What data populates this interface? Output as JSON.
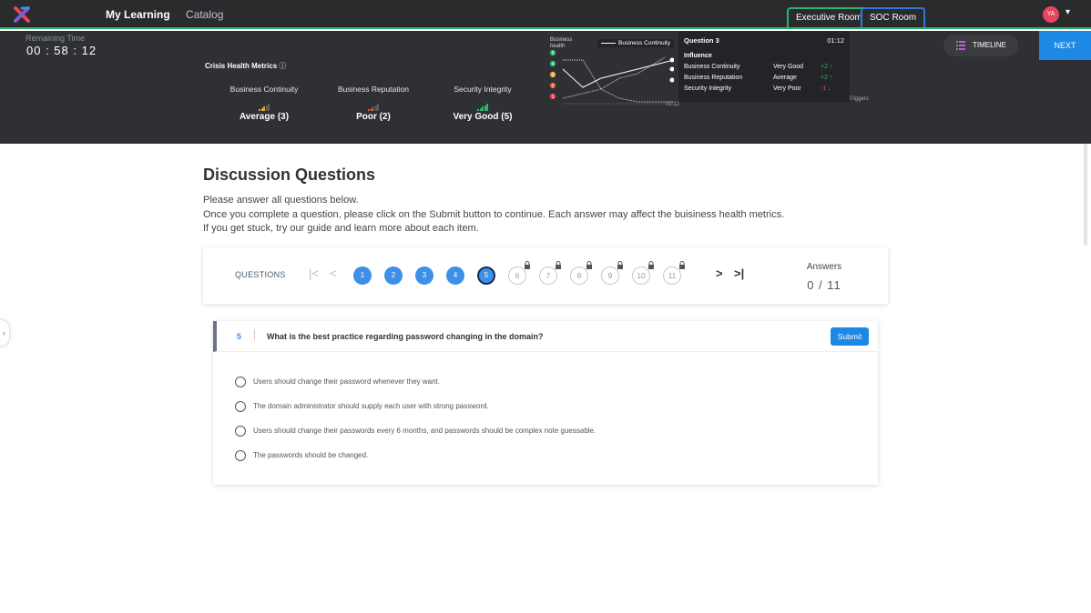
{
  "nav": {
    "links": [
      "My Learning",
      "Catalog"
    ],
    "rooms": [
      "Executive Room",
      "SOC Room"
    ],
    "avatar_initials": "YA",
    "colors": {
      "active_room": "#2fb36d",
      "soc_room": "#2f79d8",
      "avatar": "#e5455d"
    }
  },
  "timer": {
    "label": "Remaining Time",
    "value": "00 : 58 : 12"
  },
  "metrics": {
    "title": "Crisis Health Metrics",
    "items": [
      {
        "name": "Business Continuity",
        "value": "Average (3)",
        "level": 3,
        "color": "#e8a33a"
      },
      {
        "name": "Business Reputation",
        "value": "Poor (2)",
        "level": 2,
        "color": "#e85a3a"
      },
      {
        "name": "Security Integrity",
        "value": "Very Good (5)",
        "level": 5,
        "color": "#2fb36d"
      }
    ]
  },
  "health_chart": {
    "y_label_line1": "Business",
    "y_label_line2": "health",
    "legend": "Business Continuity",
    "levels": [
      5,
      4,
      3,
      2,
      1
    ],
    "level_colors": [
      "#2fb36d",
      "#2fb36d",
      "#e8a33a",
      "#e85a3a",
      "#e5455d"
    ],
    "x_tick": "01:12",
    "triggers_label": "Triggers"
  },
  "tooltip": {
    "header": "Question 3",
    "time": "01:12",
    "influence_label": "Influence",
    "rows": [
      {
        "metric": "Business Continuity",
        "rating": "Very Good",
        "delta": "+2 ↑",
        "up": true
      },
      {
        "metric": "Business Reputation",
        "rating": "Average",
        "delta": "+2 ↑",
        "up": true
      },
      {
        "metric": "Security Integrity",
        "rating": "Very Poor",
        "delta": "-1 ↓",
        "up": false
      }
    ]
  },
  "actions": {
    "timeline": "TIMELINE",
    "next": "NEXT"
  },
  "discussion": {
    "title": "Discussion Questions",
    "lines": [
      "Please answer all questions below.",
      "Once you complete a question, please click on the Submit button to continue. Each answer may affect the buisiness health metrics.",
      "If you get stuck, try our guide and learn more about each item."
    ]
  },
  "questions_nav": {
    "label": "QUESTIONS",
    "first": "|<",
    "prev": "<",
    "next": ">",
    "last": ">|",
    "numbers": [
      "1",
      "2",
      "3",
      "4",
      "5",
      "6",
      "7",
      "8",
      "9",
      "10",
      "11"
    ],
    "answers_label": "Answers",
    "answers_count": "0 / 11"
  },
  "question": {
    "number": "5",
    "text": "What is the best practice regarding password changing in the domain?",
    "submit": "Submit",
    "options": [
      "Users should change their password whenever they want.",
      "The domain administrator should supply each user with strong password.",
      "Users should change their passwords every 6 months, and passwords should be complex note guessable.",
      "The passwords should be changed."
    ]
  }
}
